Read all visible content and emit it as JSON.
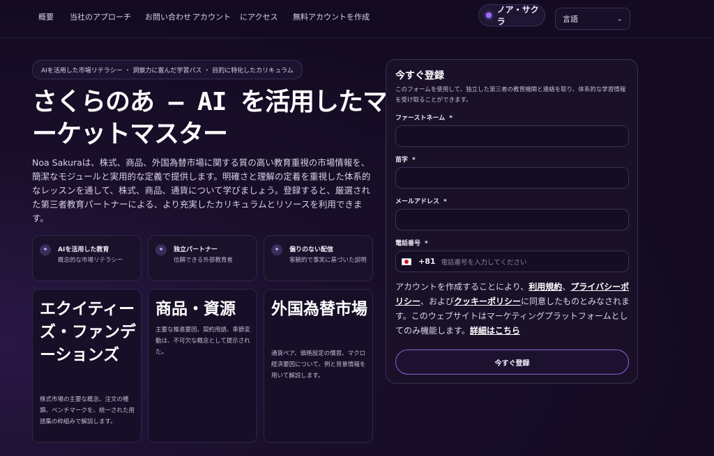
{
  "nav": {
    "items": [
      "概要",
      "当社のアプローチ",
      "お問い合わせ",
      "アカウント",
      "にアクセス",
      "無料アカウントを作成"
    ]
  },
  "brand": {
    "name": "ノア・サクラ",
    "accent": "#9b6cff"
  },
  "language": {
    "selected": "言語"
  },
  "hero": {
    "tagline": "AIを活用した市場リテラシー ・ 洞察力に富んだ学習パス ・ 目的に特化したカリキュラム",
    "title": "さくらのあ – AI を活用したマーケットマスター",
    "description": "Noa Sakuraは、株式、商品、外国為替市場に関する質の高い教育重視の市場情報を、簡潔なモジュールと実用的な定義で提供します。明確さと理解の定着を重視した体系的なレッスンを通して、株式、商品、通貨について学びましょう。登録すると、厳選された第三者教育パートナーによる、より充実したカリキュラムとリソースを利用できます。"
  },
  "features": [
    {
      "icon": "sparkle-icon",
      "title": "AIを活用した教育",
      "desc": "概念的な市場リテラシー"
    },
    {
      "icon": "sparkle-icon",
      "title": "独立パートナー",
      "desc": "信頼できる外部教育者"
    },
    {
      "icon": "sparkle-icon",
      "title": "偏りのない配信",
      "desc": "客観的で事実に基づいた説明"
    }
  ],
  "markets": [
    {
      "title": "エクイティーズ・ファンデーションズ",
      "desc": "株式市場の主要な概念、注文の種類、ベンチマークを、統一された用語集の枠組みで解説します。"
    },
    {
      "title": "商品・資源",
      "desc": "主要な推進要因、契約用語、季節変動は、不可欠な概念として提示された。"
    },
    {
      "title": "外国為替市場",
      "desc": "通貨ペア、価格設定の慣習、マクロ経済要因について、例と背景情報を用いて解説します。"
    }
  ],
  "form": {
    "title": "今すぐ登録",
    "subtitle": "このフォームを使用して、独立した第三者の教育機関と連絡を取り、体系的な学習情報を受け取ることができます。",
    "first_name_label": "ファーストネーム",
    "last_name_label": "苗字",
    "email_label": "メールアドレス",
    "phone_label": "電話番号",
    "required_mark": "*",
    "phone_code": "+81",
    "phone_placeholder": "電話番号を入力してください",
    "consent": {
      "p1": "アカウントを作成することにより、",
      "terms": "利用規約",
      "sep1": "、",
      "privacy": "プライバシーポリシー",
      "p2": "、および",
      "cookie": "クッキーポリシー",
      "p3": "に同意したものとみなされます。このウェブサイトはマーケティングプラットフォームとしてのみ機能します。",
      "details": "詳細はこちら"
    },
    "submit_label": "今すぐ登録"
  }
}
